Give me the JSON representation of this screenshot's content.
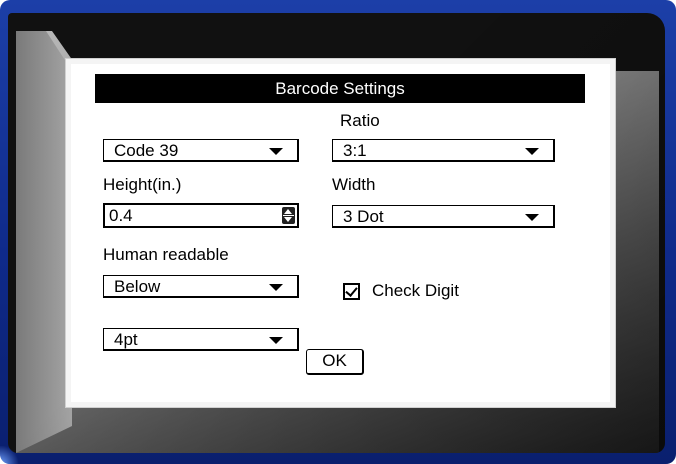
{
  "dialog": {
    "title": "Barcode Settings",
    "symbology": {
      "value": "Code 39"
    },
    "ratio": {
      "label": "Ratio",
      "value": "3:1"
    },
    "height": {
      "label": "Height(in.)",
      "value": "0.4"
    },
    "width": {
      "label": "Width",
      "value": "3 Dot"
    },
    "human_readable": {
      "label": "Human readable",
      "value": "Below"
    },
    "check_digit": {
      "label": "Check Digit",
      "checked": true
    },
    "text_size": {
      "value": "4pt"
    },
    "ok_label": "OK"
  },
  "icons": [
    "dropdown-arrow-icon",
    "spinner-up-icon",
    "spinner-down-icon",
    "checkmark-icon"
  ],
  "colors": {
    "frame": "#1c3fa8",
    "title_bar": "#000000",
    "dialog_bg": "#ffffff"
  }
}
